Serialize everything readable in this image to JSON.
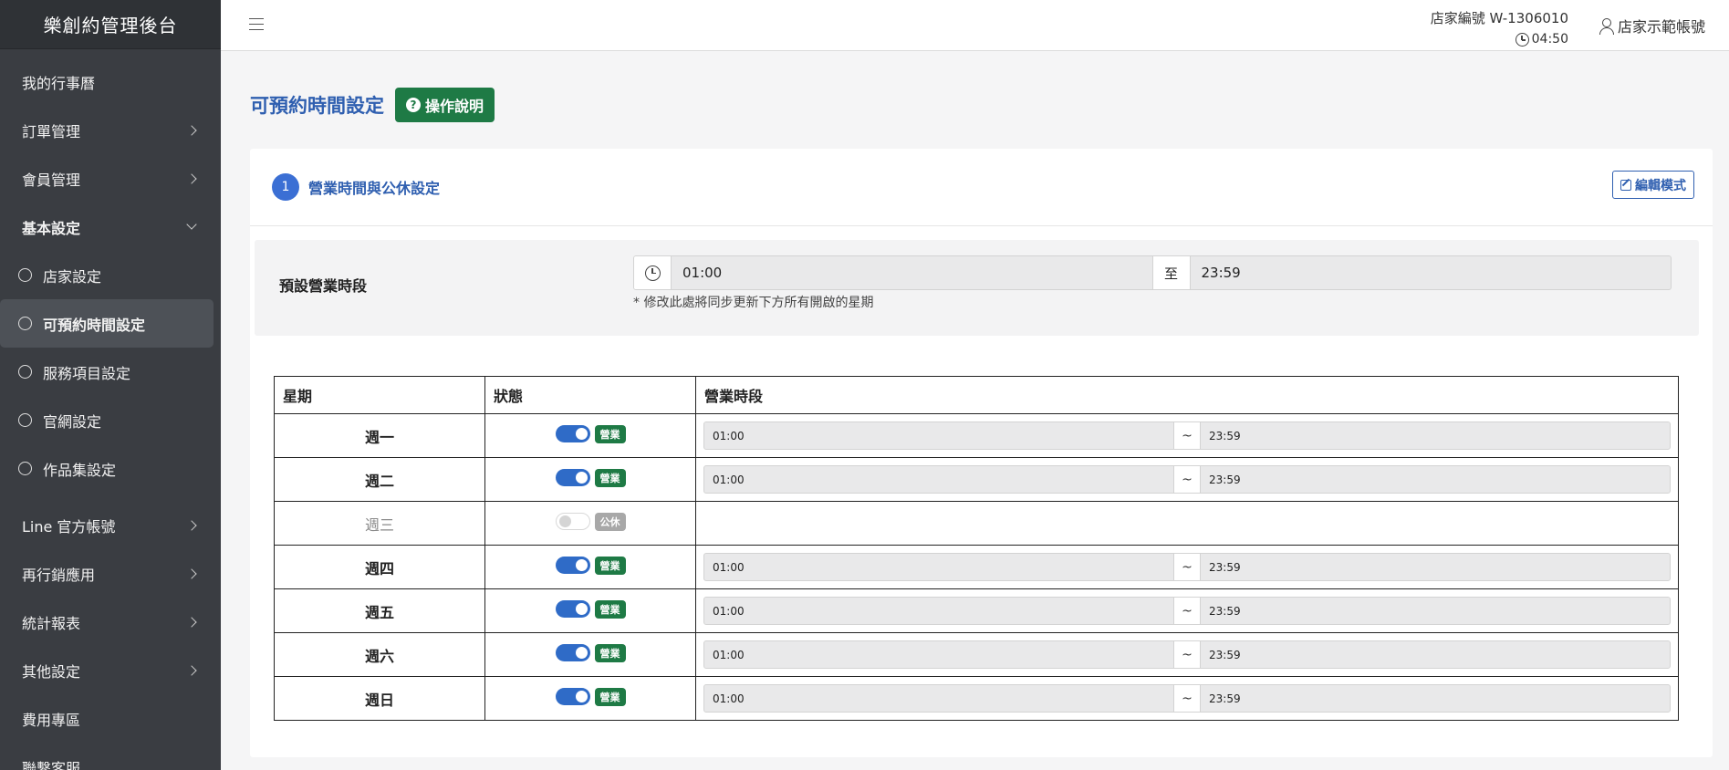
{
  "app": {
    "title": "樂創約管理後台"
  },
  "sidebar": {
    "items": [
      {
        "label": "我的行事曆"
      },
      {
        "label": "訂單管理"
      },
      {
        "label": "會員管理"
      },
      {
        "label": "基本設定"
      }
    ],
    "sub_items": [
      {
        "label": "店家設定"
      },
      {
        "label": "可預約時間設定"
      },
      {
        "label": "服務項目設定"
      },
      {
        "label": "官網設定"
      },
      {
        "label": "作品集設定"
      }
    ],
    "bottom_items": [
      {
        "label": "Line 官方帳號"
      },
      {
        "label": "再行銷應用"
      },
      {
        "label": "統計報表"
      },
      {
        "label": "其他設定"
      },
      {
        "label": "費用專區"
      },
      {
        "label": "聯繫客服"
      }
    ],
    "active_sub": "可預約時間設定"
  },
  "header": {
    "store_id": "店家編號 W-1306010",
    "time": "04:50",
    "account": "店家示範帳號"
  },
  "page": {
    "title": "可預約時間設定",
    "help_label": "操作說明"
  },
  "section": {
    "step": "1",
    "title": "營業時間與公休設定",
    "edit_label": "編輯模式",
    "default_label": "預設營業時段",
    "default_start": "01:00",
    "default_sep": "至",
    "default_end": "23:59",
    "hint": "* 修改此處將同步更新下方所有開啟的星期"
  },
  "table": {
    "headers": [
      "星期",
      "狀態",
      "營業時段"
    ],
    "rows": [
      {
        "day": "週一",
        "open": true,
        "status": "營業",
        "start": "01:00",
        "sep": "~",
        "end": "23:59"
      },
      {
        "day": "週二",
        "open": true,
        "status": "營業",
        "start": "01:00",
        "sep": "~",
        "end": "23:59"
      },
      {
        "day": "週三",
        "open": false,
        "status": "公休",
        "start": "",
        "sep": "",
        "end": ""
      },
      {
        "day": "週四",
        "open": true,
        "status": "營業",
        "start": "01:00",
        "sep": "~",
        "end": "23:59"
      },
      {
        "day": "週五",
        "open": true,
        "status": "營業",
        "start": "01:00",
        "sep": "~",
        "end": "23:59"
      },
      {
        "day": "週六",
        "open": true,
        "status": "營業",
        "start": "01:00",
        "sep": "~",
        "end": "23:59"
      },
      {
        "day": "週日",
        "open": true,
        "status": "營業",
        "start": "01:00",
        "sep": "~",
        "end": "23:59"
      }
    ]
  },
  "colors": {
    "sidebar_bg": "#3a3d42",
    "accent_blue": "#2f5fb0",
    "open_green": "#1e7a45",
    "closed_gray": "#a8a8a8"
  }
}
